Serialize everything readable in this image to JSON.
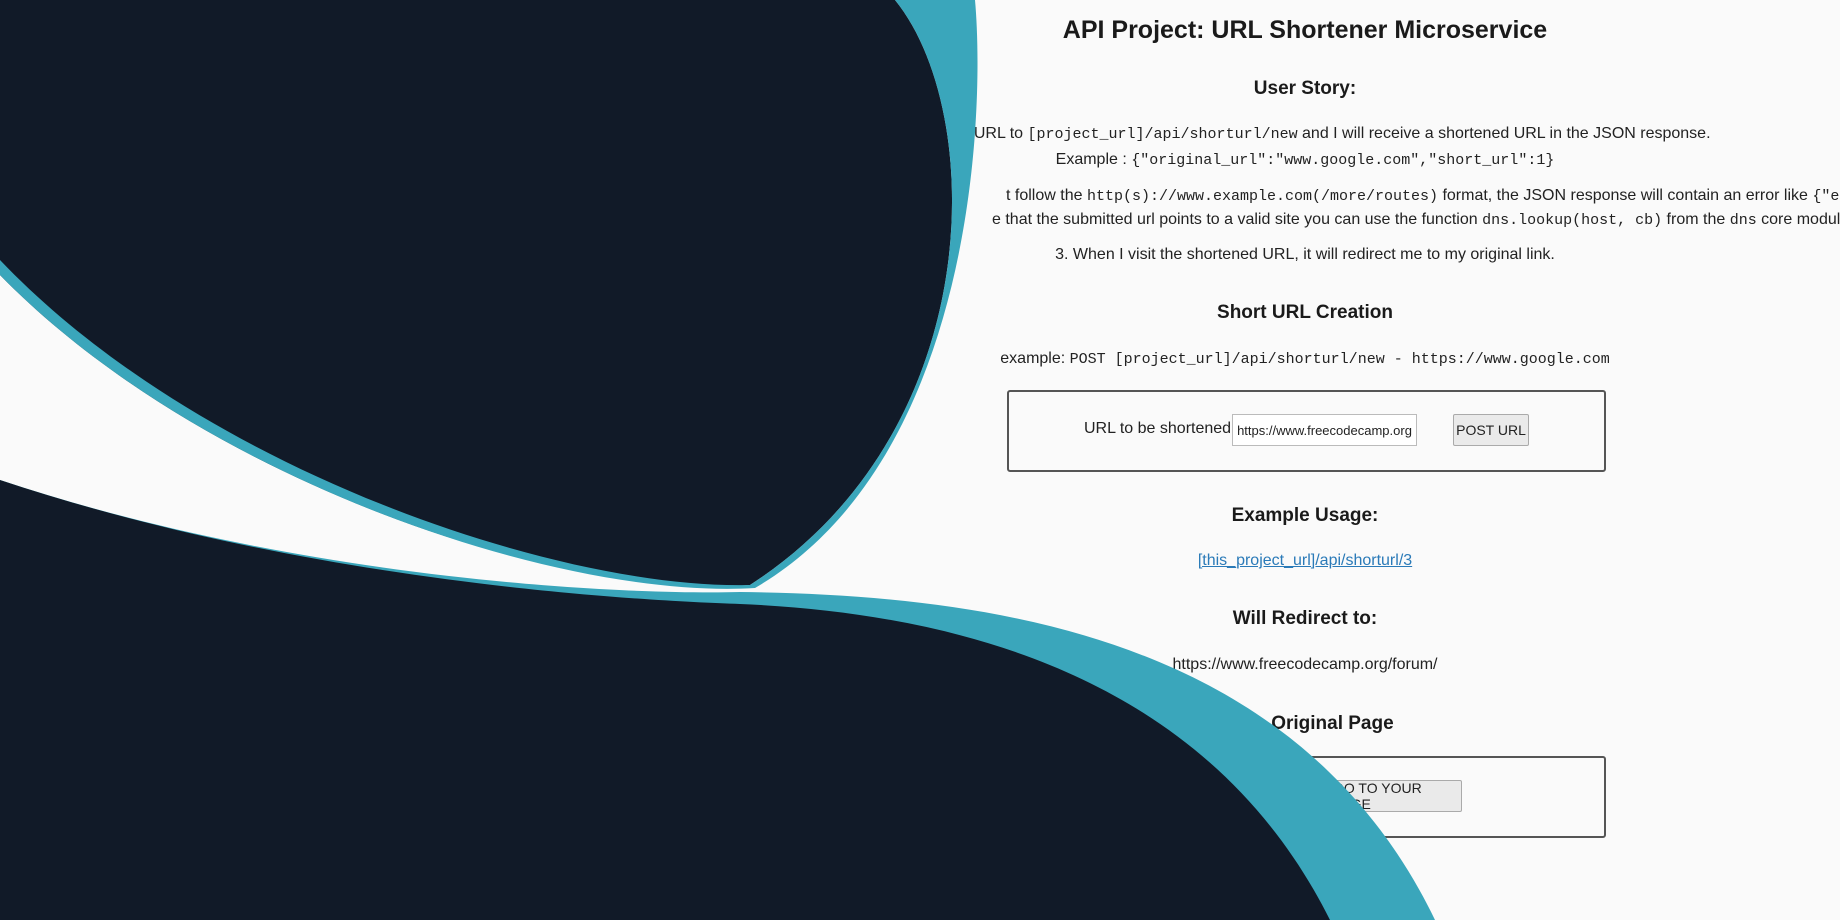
{
  "page": {
    "title": "API Project: URL Shortener Microservice",
    "user_story_heading": "User Story:",
    "story1_prefix": "n POST a URL to ",
    "story1_code": "[project_url]/api/shorturl/new",
    "story1_suffix": " and I will receive a shortened URL in the JSON response.",
    "example_label": "Example : ",
    "example_code": "{\"original_url\":\"www.google.com\",\"short_url\":1}",
    "story2_prefix": "t follow the ",
    "story2_code1": "http(s)://www.example.com(/more/routes)",
    "story2_mid": " format, the JSON response will contain an error like ",
    "story2_code2": "{\"error\":\"inval",
    "story2b_prefix": "e that the submitted url points to a valid site you can use the function ",
    "story2b_code1": "dns.lookup(host, cb)",
    "story2b_mid": " from the ",
    "story2b_code2": "dns",
    "story2b_suffix": " core module.",
    "story3": "3. When I visit the shortened URL, it will redirect me to my original link.",
    "short_url_heading": "Short URL Creation",
    "creation_example_label": "example: ",
    "creation_example_code": "POST [project_url]/api/shorturl/new - https://www.google.com",
    "form_label": "URL to be shortened",
    "form_input_value": "https://www.freecodecamp.org",
    "form_button": "POST URL",
    "usage_heading": "Example Usage:",
    "usage_link": "[this_project_url]/api/shorturl/3",
    "redirect_heading": "Will Redirect to:",
    "redirect_url": "https://www.freecodecamp.org/forum/",
    "original_heading": "Go to Original Page",
    "go_button": "GO TO YOUR PAGE"
  },
  "colors": {
    "navy": "#111a28",
    "teal": "#3aa6bb",
    "page_bg": "#fafafa",
    "link": "#2a7ab8"
  }
}
